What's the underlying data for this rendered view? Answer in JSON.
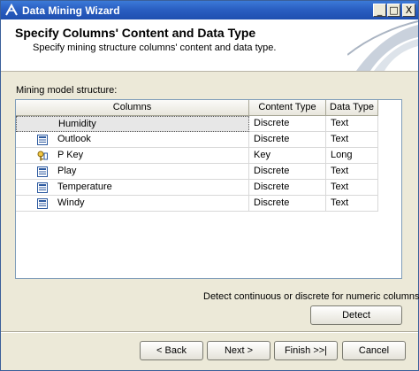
{
  "window": {
    "title": "Data Mining Wizard",
    "minimize": "_",
    "maximize": "□",
    "close": "X"
  },
  "header": {
    "title": "Specify Columns' Content and Data Type",
    "subtitle": "Specify mining structure columns' content and data type."
  },
  "structure_label": "Mining model structure:",
  "grid": {
    "headers": [
      "Columns",
      "Content Type",
      "Data Type"
    ],
    "rows": [
      {
        "icon": "column-icon",
        "name": "Humidity",
        "content_type": "Discrete",
        "data_type": "Text",
        "selected": true
      },
      {
        "icon": "column-icon",
        "name": "Outlook",
        "content_type": "Discrete",
        "data_type": "Text"
      },
      {
        "icon": "key-icon",
        "name": "P Key",
        "content_type": "Key",
        "data_type": "Long"
      },
      {
        "icon": "column-icon",
        "name": "Play",
        "content_type": "Discrete",
        "data_type": "Text"
      },
      {
        "icon": "column-icon",
        "name": "Temperature",
        "content_type": "Discrete",
        "data_type": "Text"
      },
      {
        "icon": "column-icon",
        "name": "Windy",
        "content_type": "Discrete",
        "data_type": "Text"
      }
    ]
  },
  "detect": {
    "label": "Detect continuous or discrete for numeric columns:",
    "button": "Detect"
  },
  "nav": {
    "back": "< Back",
    "next": "Next >",
    "finish": "Finish >>|",
    "cancel": "Cancel"
  },
  "colors": {
    "titlebar": "#2a5fc2",
    "window_bg": "#ece9d8",
    "selection": "#e7e7e7"
  }
}
